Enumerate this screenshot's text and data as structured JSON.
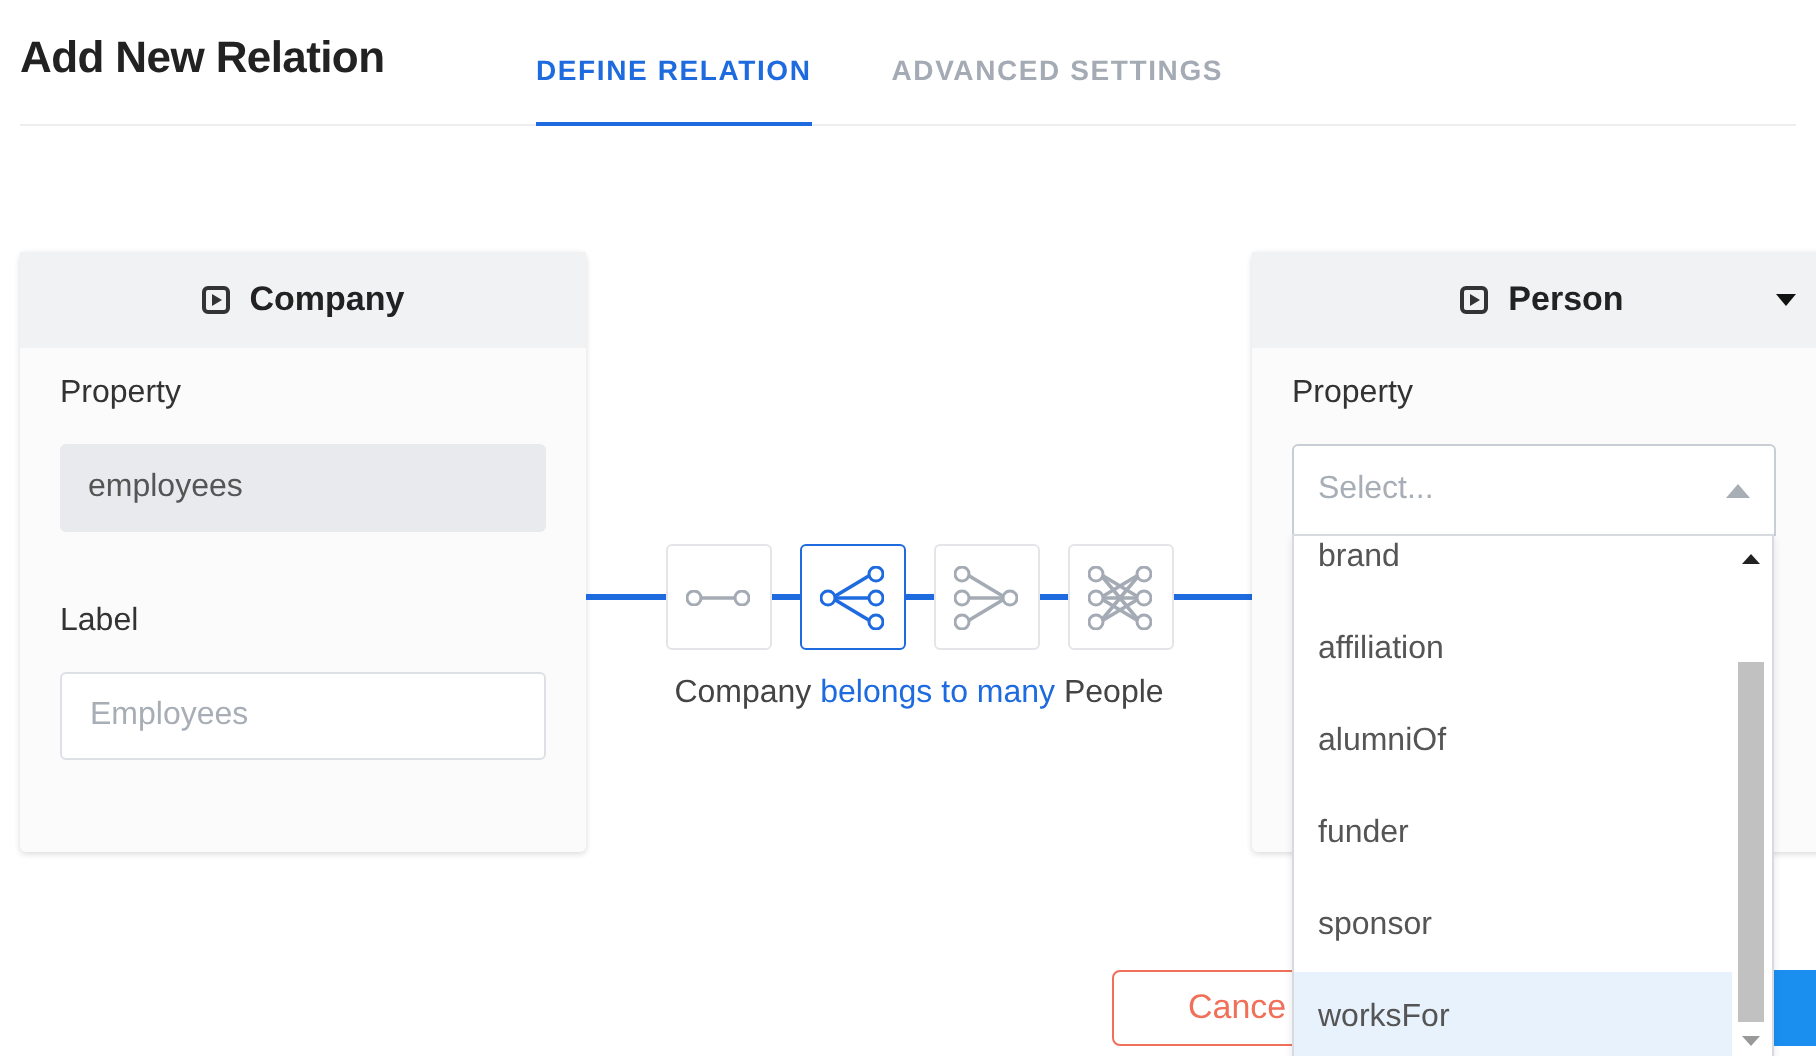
{
  "dialog": {
    "title": "Add New Relation"
  },
  "tabs": [
    {
      "label": "DEFINE RELATION",
      "selected": true
    },
    {
      "label": "ADVANCED SETTINGS",
      "selected": false
    }
  ],
  "source": {
    "entity": "Company",
    "property_label": "Property",
    "property_value": "employees",
    "label_label": "Label",
    "label_placeholder": "Employees"
  },
  "relation_types": [
    {
      "kind": "one-to-one",
      "selected": false
    },
    {
      "kind": "one-to-many",
      "selected": true
    },
    {
      "kind": "many-to-one",
      "selected": false
    },
    {
      "kind": "many-to-many",
      "selected": false
    }
  ],
  "relation_caption": {
    "from": "Company",
    "relation": "belongs to many",
    "to": "People"
  },
  "target": {
    "entity": "Person",
    "property_label": "Property",
    "property_placeholder": "Select...",
    "expanded": true,
    "options": [
      {
        "label": "brand",
        "selected": false
      },
      {
        "label": "affiliation",
        "selected": false
      },
      {
        "label": "alumniOf",
        "selected": false
      },
      {
        "label": "funder",
        "selected": false
      },
      {
        "label": "sponsor",
        "selected": false
      },
      {
        "label": "worksFor",
        "selected": true
      }
    ]
  },
  "footer": {
    "cancel": "Cance"
  }
}
